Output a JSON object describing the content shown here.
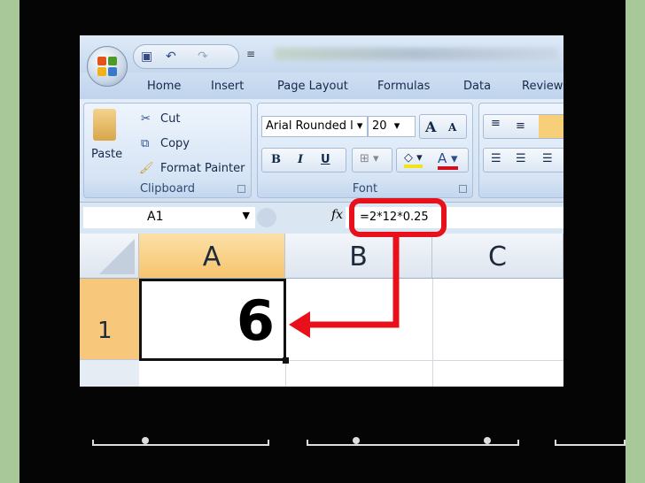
{
  "ribbon": {
    "tabs": [
      "Home",
      "Insert",
      "Page Layout",
      "Formulas",
      "Data",
      "Review"
    ],
    "clipboard": {
      "paste": "Paste",
      "cut": "Cut",
      "copy": "Copy",
      "format_painter": "Format Painter",
      "label": "Clipboard"
    },
    "font": {
      "name": "Arial Rounded l",
      "size": "20",
      "bold": "B",
      "italic": "I",
      "underline": "U",
      "grow": "A",
      "shrink": "A",
      "label": "Font"
    }
  },
  "formula_bar": {
    "name_box": "A1",
    "fx": "fx",
    "formula": "=2*12*0.25"
  },
  "sheet": {
    "columns": [
      "A",
      "B",
      "C"
    ],
    "rows": [
      "1"
    ],
    "cells": {
      "A1": "6"
    }
  },
  "colors": {
    "callout": "#e8101b",
    "selected_row_header": "#f7c77c",
    "background": "#a9c89a"
  }
}
